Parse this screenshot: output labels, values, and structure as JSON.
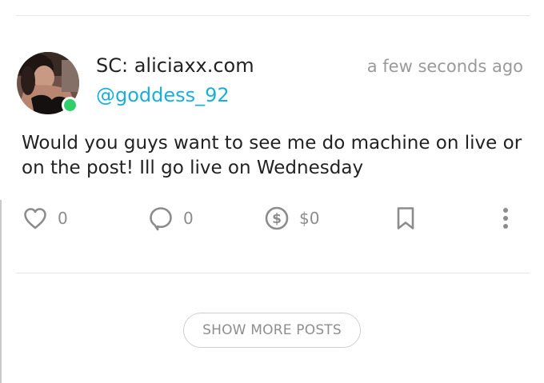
{
  "post": {
    "author": {
      "display_name": "SC: aliciaxx.com",
      "handle": "@goddess_92",
      "online": true
    },
    "timestamp": "a few seconds ago",
    "text": "Would you guys want to see me do machine on live or on the post! Ill go live on Wednesday",
    "actions": {
      "like_count": "0",
      "comment_count": "0",
      "tip_amount": "$0"
    },
    "icons": {
      "like": "heart-icon",
      "comment": "comment-bubble-icon",
      "tip": "dollar-coin-icon",
      "bookmark": "bookmark-icon",
      "more": "more-vertical-icon"
    }
  },
  "footer": {
    "show_more_label": "SHOW MORE POSTS"
  },
  "colors": {
    "accent": "#1aaedc",
    "online": "#2fcf6a",
    "icon_gray": "#8c8c8c",
    "divider": "#e6e6e6"
  }
}
